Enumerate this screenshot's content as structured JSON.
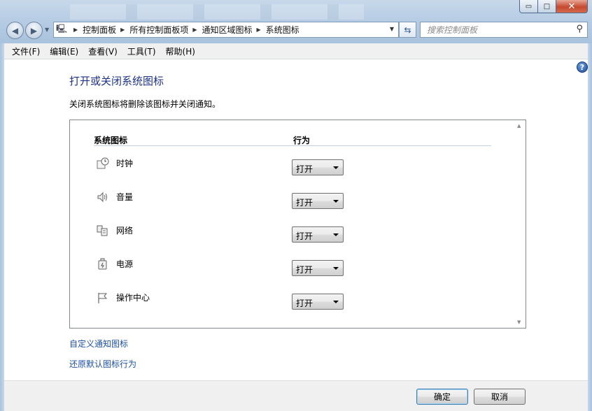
{
  "window": {
    "minimize_glyph": "▭",
    "maximize_glyph": "□",
    "close_glyph": "✕"
  },
  "nav": {
    "back_glyph": "◀",
    "forward_glyph": "▶"
  },
  "breadcrumb": [
    {
      "label": "控制面板"
    },
    {
      "label": "所有控制面板项"
    },
    {
      "label": "通知区域图标"
    },
    {
      "label": "系统图标"
    }
  ],
  "search": {
    "placeholder": "搜索控制面板"
  },
  "menu": [
    {
      "label": "文件(F)"
    },
    {
      "label": "编辑(E)"
    },
    {
      "label": "查看(V)"
    },
    {
      "label": "工具(T)"
    },
    {
      "label": "帮助(H)"
    }
  ],
  "main": {
    "title": "打开或关闭系统图标",
    "description": "关闭系统图标将删除该图标并关闭通知。",
    "table": {
      "col_icon": "系统图标",
      "col_behavior": "行为",
      "rows": [
        {
          "icon": "clock-icon",
          "label": "时钟",
          "value": "打开"
        },
        {
          "icon": "volume-icon",
          "label": "音量",
          "value": "打开"
        },
        {
          "icon": "network-icon",
          "label": "网络",
          "value": "打开"
        },
        {
          "icon": "power-icon",
          "label": "电源",
          "value": "打开"
        },
        {
          "icon": "action-center-flag-icon",
          "label": "操作中心",
          "value": "打开"
        }
      ]
    },
    "links": {
      "customize": "自定义通知图标",
      "restore": "还原默认图标行为"
    }
  },
  "footer": {
    "ok_label": "确定",
    "cancel_label": "取消"
  },
  "colors": {
    "title": "#1e3287",
    "link": "#1e50a2"
  }
}
